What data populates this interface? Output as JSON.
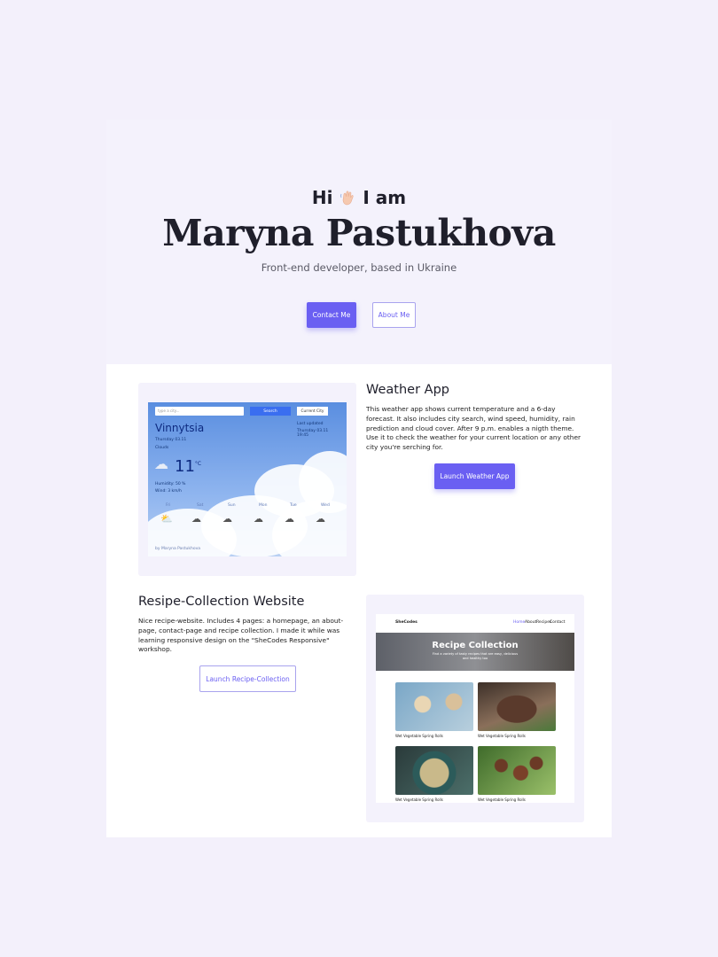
{
  "hero": {
    "greeting": "Hi",
    "greeting_suffix": "I am",
    "name": "Maryna Pastukhova",
    "role": "Front-end developer, based in Ukraine",
    "contact_label": "Contact Me",
    "about_label": "About Me"
  },
  "projects": [
    {
      "title": "Weather App",
      "description": "This weather app shows current temperature and a 6-day forecast. It also includes city search, wind speed, humidity, rain prediction and cloud cover. After 9 p.m. enables a nigth theme. Use it to check the weather for your current location or any other city you're serching for.",
      "button_label": "Launch Weather App"
    },
    {
      "title": "Resipe-Collection Website",
      "description": "Nice recipe-website. Includes 4 pages: a homepage, an about-page, contact-page and recipe collection. I made it while was learning responsive design on the \"SheCodes Responsive\" workshop.",
      "button_label": "Launch Recipe-Collection"
    }
  ],
  "weather_preview": {
    "search_placeholder": "type a city...",
    "search_label": "Search",
    "current_label": "Current City",
    "city": "Vinnytsia",
    "date": "Thursday 03.11",
    "condition": "Clouds",
    "temperature": "11",
    "unit": "°C",
    "humidity": "Humidity: 50 %",
    "wind": "Wind: 3 km/h",
    "updated": "Last updated",
    "updated_time": "Thursday 03.11 19:45",
    "days": [
      "Fri",
      "Sat",
      "Sun",
      "Mon",
      "Tue",
      "Wed"
    ],
    "footer": "by Maryna Pastukhova"
  },
  "recipe_preview": {
    "brand": "SheCodes",
    "nav": [
      "Home",
      "About",
      "Recipes",
      "Contact"
    ],
    "banner_title": "Recipe Collection",
    "banner_sub": "Find a variety of tasty recipes that are easy, delicious and healthy too",
    "caption": "Wet Vegetable Spring Rolls"
  },
  "colors": {
    "accent": "#6a5ff2",
    "page_bg": "#f3f0fb",
    "hero_bg": "#f4f2fc"
  }
}
